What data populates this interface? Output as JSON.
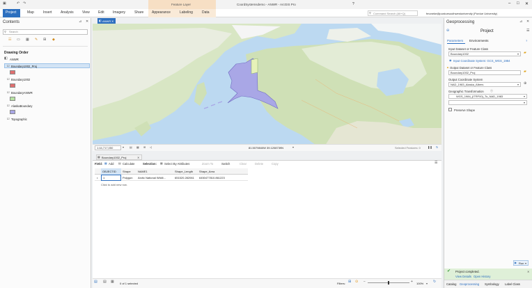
{
  "window": {
    "title": "CoordSystemsdemo - ANWR - ArcGIS Pro",
    "help": "?",
    "context_tab_group": "Feature Layer",
    "search_placeholder": "Command Search (Alt+Q)",
    "user": "fmoneke@purduesouthwestuniversity (Purdue University)"
  },
  "ribbon": {
    "tabs": [
      "Project",
      "Map",
      "Insert",
      "Analysis",
      "View",
      "Edit",
      "Imagery",
      "Share",
      "Appearance",
      "Labeling",
      "Data"
    ]
  },
  "contents": {
    "title": "Contents",
    "search_placeholder": "Search",
    "drawing_order": "Drawing Order",
    "map_name": "ANWR",
    "layers": [
      {
        "name": "Boundary1002_Proj",
        "color": "#e06f6f",
        "selected": true
      },
      {
        "name": "Boundary1002",
        "color": "#e06f6f"
      },
      {
        "name": "BoundaryANWR",
        "color": "#b8e3a4"
      },
      {
        "name": "AlaskaBoundary",
        "color": "#a9a7e6"
      },
      {
        "name": "Topographic",
        "color": ""
      }
    ]
  },
  "map_view": {
    "tab_label": "ANWR",
    "scale": "1:44,717,050",
    "coordinates": "81.5079840W 39.1208739N",
    "selected_features": "Selected Features: 0"
  },
  "table_view": {
    "tab_label": "Boundary1002_Proj",
    "toolbar": {
      "field": "Field:",
      "add": "Add",
      "calculate": "Calculate",
      "selection": "Selection:",
      "select_by_attributes": "Select By Attributes",
      "zoom_to": "Zoom To",
      "switch": "Switch",
      "clear": "Clear",
      "delete": "Delete",
      "copy": "Copy"
    },
    "columns": [
      "OBJECTID",
      "Shape",
      "NAME1",
      "Shape_Length",
      "Shape_Area"
    ],
    "rows": [
      [
        "1",
        "Polygon",
        "Arctic National Wildli...",
        "651520.282061",
        "6450477810.861223"
      ]
    ],
    "add_row_hint": "Click to add new row.",
    "status": "0 of 1 selected",
    "filters_label": "Filters:",
    "zoom": "100%"
  },
  "geoprocessing": {
    "title": "Geoprocessing",
    "tool_title": "Project",
    "tabs": [
      "Parameters",
      "Environments"
    ],
    "input_label": "Input Dataset or Feature Class",
    "input_value": "Boundary1002",
    "input_cs": "Input Coordinate System: GCS_WGS_1984",
    "output_label": "Output Dataset or Feature Class",
    "output_value": "Boundary1002_Proj",
    "out_cs_label": "Output Coordinate System",
    "out_cs_value": "NAD_1983_Alaska_Albers",
    "transform_label": "Geographic Transformation",
    "transform_value": "WGS_1984_(ITRF00)_To_NAD_1983",
    "preserve_shape": "Preserve Shape",
    "run": "Run",
    "completed": "Project completed.",
    "view_details": "View Details",
    "open_history": "Open History",
    "bottom_tabs": [
      "Catalog",
      "Geoprocessing",
      "Symbology",
      "Label Class"
    ]
  }
}
